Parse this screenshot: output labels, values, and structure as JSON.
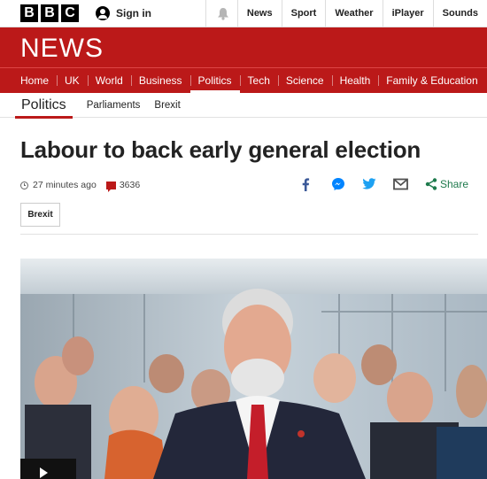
{
  "brand": {
    "letters": [
      "B",
      "B",
      "C"
    ]
  },
  "topbar": {
    "signin_label": "Sign in",
    "signin_icon": "user-icon",
    "notifications_icon": "bell-icon",
    "nav": [
      "News",
      "Sport",
      "Weather",
      "iPlayer",
      "Sounds"
    ]
  },
  "banner": {
    "wordmark": "NEWS"
  },
  "main_nav": {
    "items": [
      "Home",
      "UK",
      "World",
      "Business",
      "Politics",
      "Tech",
      "Science",
      "Health",
      "Family & Education"
    ],
    "active": "Politics"
  },
  "sub_nav": {
    "current": "Politics",
    "links": [
      "Parliaments",
      "Brexit"
    ]
  },
  "article": {
    "headline": "Labour to back early general election",
    "timestamp": "27 minutes ago",
    "comment_count": "3636",
    "share_label": "Share",
    "share_icons": [
      "facebook-icon",
      "messenger-icon",
      "twitter-icon",
      "email-icon",
      "share-icon"
    ],
    "tag": "Brexit"
  },
  "colors": {
    "brand_red": "#bb1919",
    "share_green": "#1e7a4c",
    "facebook_blue": "#3b5998",
    "messenger_blue": "#0084ff",
    "twitter_blue": "#1da1f2"
  }
}
